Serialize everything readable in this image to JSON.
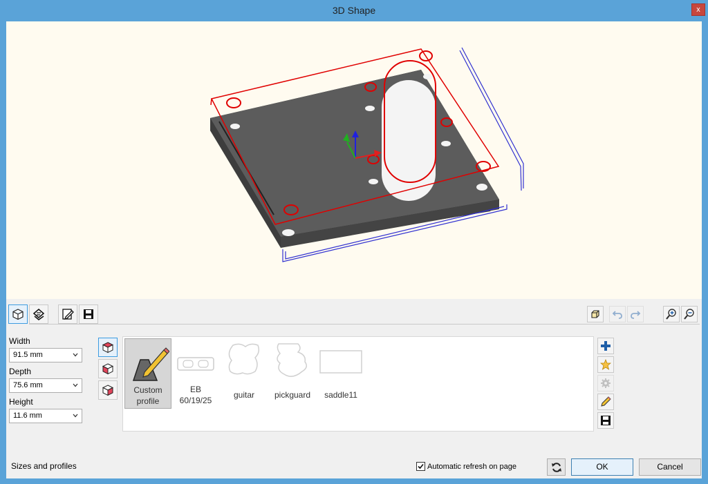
{
  "window": {
    "title": "3D Shape",
    "close_label": "x"
  },
  "toolbar": {
    "left_icons": [
      "3d-view-icon",
      "shape-edit-icon",
      "edit-page-icon",
      "save-icon"
    ],
    "right_icons": [
      "box-view-icon",
      "undo-icon",
      "redo-icon",
      "zoom-in-icon",
      "zoom-out-icon"
    ]
  },
  "sizes": {
    "width_label": "Width",
    "width_value": "91.5 mm",
    "depth_label": "Depth",
    "depth_value": "75.6 mm",
    "height_label": "Height",
    "height_value": "11.6 mm"
  },
  "profiles": [
    {
      "line1": "Custom",
      "line2": "profile",
      "icon": "custom-profile-icon",
      "selected": true
    },
    {
      "line1": "EB",
      "line2": "60/19/25",
      "icon": "eb-profile-icon",
      "selected": false
    },
    {
      "line1": "guitar",
      "line2": "",
      "icon": "guitar-icon",
      "selected": false
    },
    {
      "line1": "pickguard",
      "line2": "",
      "icon": "pickguard-icon",
      "selected": false
    },
    {
      "line1": "saddle11",
      "line2": "",
      "icon": "saddle-icon",
      "selected": false
    }
  ],
  "status": {
    "text": "Sizes and profiles"
  },
  "options": {
    "auto_refresh_label": "Automatic refresh on page",
    "auto_refresh_checked": true
  },
  "buttons": {
    "ok": "OK",
    "cancel": "Cancel"
  },
  "colors": {
    "accent": "#3c9be0",
    "title_bar": "#5aa3d8",
    "viewport_bg": "#fffbf0",
    "outline_red": "#e00000",
    "outline_blue": "#3030d0"
  }
}
